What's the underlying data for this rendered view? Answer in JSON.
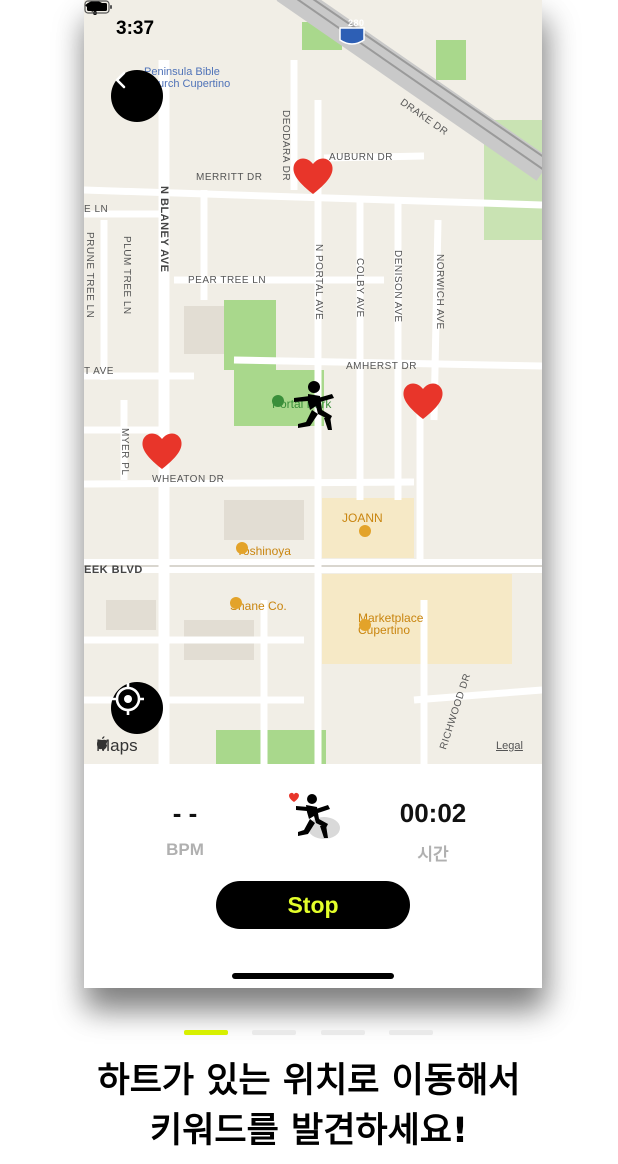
{
  "status": {
    "time": "3:37"
  },
  "map": {
    "pois": {
      "church": "Peninsula Bible\nChurch Cupertino",
      "park": "Portal Park",
      "joann": "JOANN",
      "yoshinoya": "Yoshinoya",
      "shane": "Shane Co.",
      "marketplace": "Marketplace\nCupertino"
    },
    "streets": {
      "auburn": "AUBURN DR",
      "drake": "DRAKE DR",
      "merritt": "MERRITT DR",
      "deodara": "DEODARA DR",
      "blaney": "N BLANEY AVE",
      "pear_tree": "PEAR TREE LN",
      "plum_tree": "PLUM TREE LN",
      "prune_tree": "PRUNE TREE LN",
      "portal": "N PORTAL AVE",
      "colby": "COLBY AVE",
      "denison": "DENISON AVE",
      "norwich": "NORWICH AVE",
      "amherst": "AMHERST DR",
      "myer": "MYER PL",
      "wheaton": "WHEATON DR",
      "creek": "EEK BLVD",
      "richwood": "RICHWOOD DR",
      "ln_left": "E LN",
      "ave_left": "T AVE",
      "highway": "280"
    },
    "maps_logo": "Maps",
    "legal": "Legal"
  },
  "stats": {
    "bpm_value": "- -",
    "bpm_label": "BPM",
    "time_value": "00:02",
    "time_label": "시간"
  },
  "stop_label": "Stop",
  "colors": {
    "accent": "#e4ff2a",
    "heart": "#e8352a",
    "park": "#a9d88c"
  },
  "pagination": {
    "count": 4,
    "active": 0
  },
  "caption": {
    "line1": "하트가 있는 위치로 이동해서",
    "line2": "키워드를 발견하세요!"
  }
}
